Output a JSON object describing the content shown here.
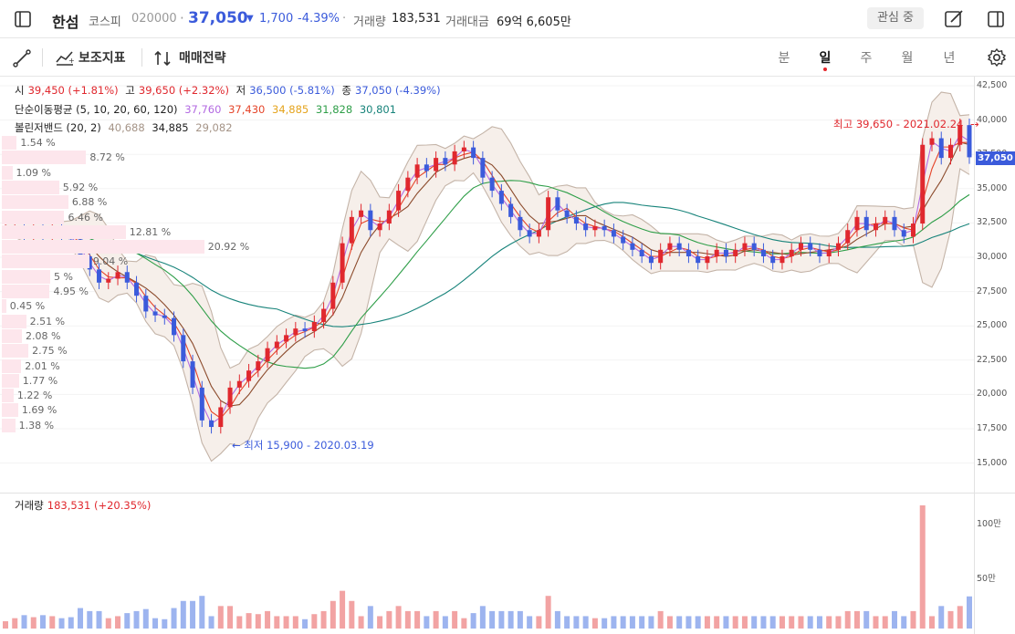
{
  "header": {
    "stock_name": "한섬",
    "market": "코스피",
    "code": "020000",
    "price": "37,050",
    "change": "1,700",
    "change_pct": "-4.39%",
    "volume_label": "거래량",
    "volume": "183,531",
    "amount_label": "거래대금",
    "amount": "69억 6,605만",
    "interest_button": "관심 중"
  },
  "toolbar": {
    "indicators": "보조지표",
    "strategy": "매매전략",
    "periods": [
      "분",
      "일",
      "주",
      "월",
      "년"
    ],
    "selected_period": "일"
  },
  "legend": {
    "ohlc": {
      "open_label": "시",
      "open": "39,450 (+1.81%)",
      "high_label": "고",
      "high": "39,650 (+2.32%)",
      "low_label": "저",
      "low": "36,500 (-5.81%)",
      "close_label": "종",
      "close": "37,050 (-4.39%)"
    },
    "ma": {
      "label": "단순이동평균 (5, 10, 20, 60, 120)",
      "values": [
        "37,760",
        "37,430",
        "34,885",
        "31,828",
        "30,801"
      ]
    },
    "bb": {
      "label": "볼린저밴드 (20, 2)",
      "values": [
        "40,688",
        "34,885",
        "29,082"
      ]
    },
    "colors": {
      "ma5": "#b36ae2",
      "ma10": "#e5452a",
      "ma20": "#e5a41e",
      "ma60": "#2e9e48",
      "ma120": "#17837a",
      "up": "#e0282e",
      "down": "#3b5bdb",
      "bb": "#a59487"
    }
  },
  "axis": {
    "price_ticks": [
      "42,500",
      "40,000",
      "37,500",
      "35,000",
      "32,500",
      "30,000",
      "27,500",
      "25,000",
      "22,500",
      "20,000",
      "17,500",
      "15,000"
    ],
    "current_price": "37,050",
    "volume_ticks": [
      "100만",
      "50만"
    ]
  },
  "annotations": {
    "high": "최고 39,650 - 2021.02.24",
    "low": "최저 15,900 - 2020.03.19"
  },
  "volume_profile": [
    "1.54 %",
    "8.72 %",
    "1.09 %",
    "5.92 %",
    "6.88 %",
    "6.46 %",
    "12.81 %",
    "20.92 %",
    "9.04 %",
    "5 %",
    "4.95 %",
    "0.45 %",
    "2.51 %",
    "2.08 %",
    "2.75 %",
    "2.01 %",
    "1.77 %",
    "1.22 %",
    "1.69 %",
    "1.38 %"
  ],
  "volume_panel": {
    "label": "거래량",
    "value": "183,531 (+20.35%)"
  },
  "chart_data": {
    "type": "candlestick",
    "ylim": [
      14000,
      42500
    ],
    "close_path": [
      31500,
      31800,
      31200,
      31600,
      31000,
      31500,
      31200,
      30800,
      29500,
      28500,
      27500,
      27800,
      28300,
      27500,
      26500,
      25300,
      25000,
      24800,
      23500,
      21500,
      19500,
      17000,
      16500,
      18000,
      19500,
      20000,
      20800,
      21500,
      22500,
      23000,
      23500,
      24000,
      23800,
      24500,
      25500,
      27500,
      30500,
      32500,
      33000,
      31500,
      32000,
      33000,
      34500,
      35500,
      36500,
      36000,
      37000,
      36500,
      37500,
      37800,
      37000,
      35500,
      34500,
      33500,
      32500,
      31500,
      31000,
      31500,
      34000,
      33000,
      32500,
      32000,
      31500,
      31800,
      31500,
      31000,
      30500,
      30000,
      29500,
      29000,
      30000,
      30500,
      30000,
      29500,
      29000,
      29500,
      30000,
      29500,
      30000,
      30500,
      30000,
      29500,
      29000,
      29500,
      30000,
      30500,
      30000,
      29500,
      30000,
      30500,
      31500,
      32500,
      31500,
      32000,
      32500,
      31500,
      31000,
      32000,
      38000,
      38500,
      37000,
      38000,
      39500,
      37050
    ]
  }
}
